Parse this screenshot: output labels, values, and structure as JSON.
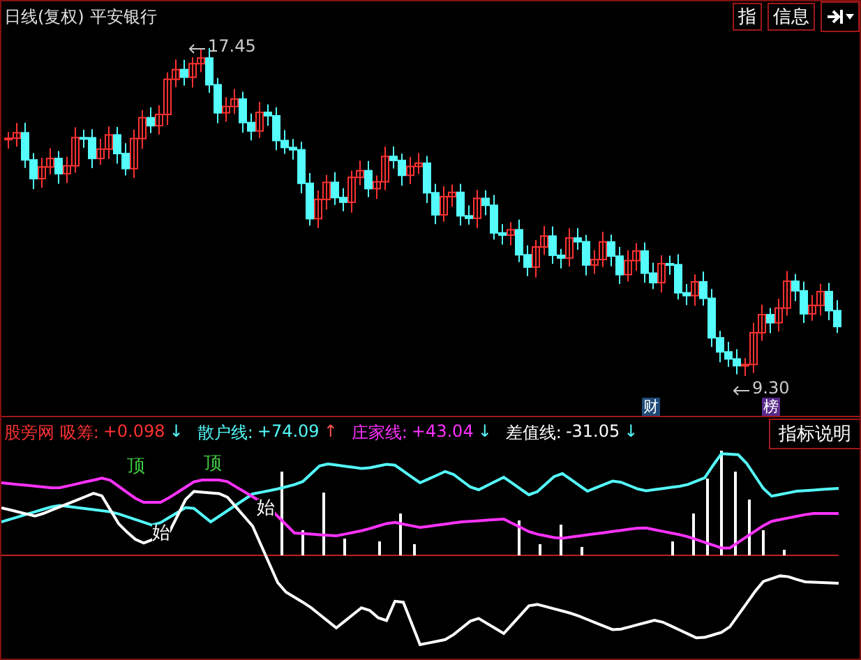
{
  "header": {
    "period": "日线(复权)",
    "stock": "平安银行",
    "buttons": [
      "指",
      "信息"
    ]
  },
  "main_chart": {
    "high_label": "17.45",
    "low_label": "9.30",
    "badges": [
      {
        "text": "财",
        "color": "#1e4a78"
      },
      {
        "text": "榜",
        "color": "#5a2a8a"
      }
    ]
  },
  "legend": [
    {
      "label": "股旁网 吸筹:",
      "value": "+0.098",
      "color": "#ff3232",
      "arrow": {
        "text": "↓",
        "color": "#54fcfc"
      }
    },
    {
      "label": "散户线:",
      "value": "+74.09",
      "color": "#54fcfc",
      "arrow": {
        "text": "↑",
        "color": "#ff5050"
      }
    },
    {
      "label": "庄家线:",
      "value": "+43.04",
      "color": "#ff32ff",
      "arrow": {
        "text": "↓",
        "color": "#54fcfc"
      }
    },
    {
      "label": "差值线:",
      "value": "-31.05",
      "color": "#ffffff",
      "arrow": {
        "text": "↓",
        "color": "#54fcfc"
      }
    }
  ],
  "indicator_button": "指标说明",
  "sub_chart": {
    "marks": [
      {
        "text": "顶",
        "color": "#40d040"
      },
      {
        "text": "顶",
        "color": "#40d040"
      },
      {
        "text": "始",
        "color": "#ffffff"
      },
      {
        "text": "始",
        "color": "#ffffff"
      }
    ]
  }
}
